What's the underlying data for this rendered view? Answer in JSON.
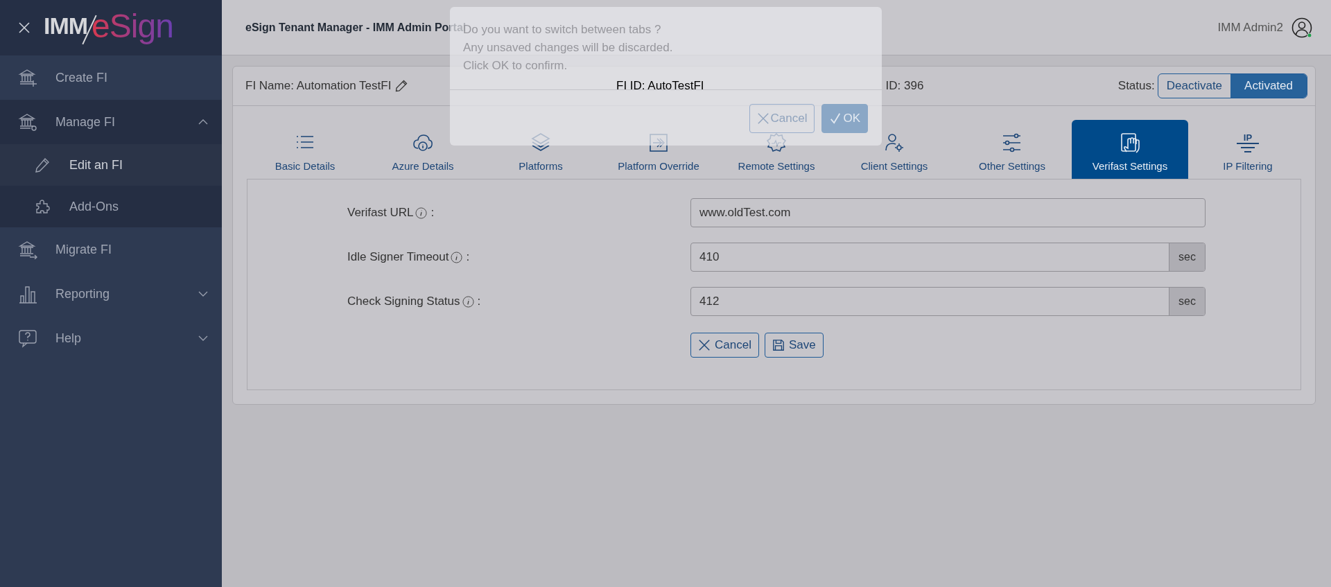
{
  "sidebar": {
    "logo": {
      "left": "IMM",
      "right": "eSign"
    },
    "items": [
      {
        "label": "Create FI",
        "selected": false
      },
      {
        "label": "Manage FI",
        "selected": false,
        "expanded": true,
        "children": [
          {
            "label": "Edit an FI",
            "selected": true
          },
          {
            "label": "Add-Ons",
            "selected": false
          }
        ]
      },
      {
        "label": "Migrate FI",
        "selected": false
      },
      {
        "label": "Reporting",
        "selected": false,
        "expanded": false
      },
      {
        "label": "Help",
        "selected": false,
        "expanded": false
      }
    ]
  },
  "header": {
    "title": "eSign Tenant Manager - IMM Admin Portal",
    "user": "IMM Admin2",
    "online": true
  },
  "info_bar": {
    "fi_name": "FI Name: Automation TestFI",
    "fi_id": "FI ID: AutoTestFI",
    "tenant_id": "ID: 396",
    "status_label": "Status:",
    "status_options": [
      {
        "label": "Deactivate",
        "selected": false
      },
      {
        "label": "Activated",
        "selected": true
      }
    ]
  },
  "tabs": [
    {
      "label": "Basic Details",
      "selected": false
    },
    {
      "label": "Azure Details",
      "selected": false
    },
    {
      "label": "Platforms",
      "selected": false
    },
    {
      "label": "Platform Override",
      "selected": false
    },
    {
      "label": "Remote Settings",
      "selected": false
    },
    {
      "label": "Client Settings",
      "selected": false
    },
    {
      "label": "Other Settings",
      "selected": false
    },
    {
      "label": "Verifast Settings",
      "selected": true
    },
    {
      "label": "IP Filtering",
      "selected": false,
      "icon_text": "IP"
    }
  ],
  "form": {
    "fields": [
      {
        "label": "Verifast URL",
        "value": "www.oldTest.com"
      },
      {
        "label": "Idle Signer Timeout",
        "value": "410",
        "unit": "sec"
      },
      {
        "label": "Check Signing Status",
        "value": "412",
        "unit": "sec"
      }
    ],
    "separator": ":",
    "buttons": [
      {
        "label": "Cancel",
        "kind": "cancel"
      },
      {
        "label": "Save",
        "kind": "save"
      }
    ]
  },
  "dialog": {
    "lines": [
      "Do you want to switch between tabs ?",
      "Any unsaved changes will be discarded.",
      "Click OK to confirm."
    ],
    "buttons": [
      {
        "label": "Cancel",
        "kind": "cancel"
      },
      {
        "label": "OK",
        "kind": "ok"
      }
    ]
  }
}
